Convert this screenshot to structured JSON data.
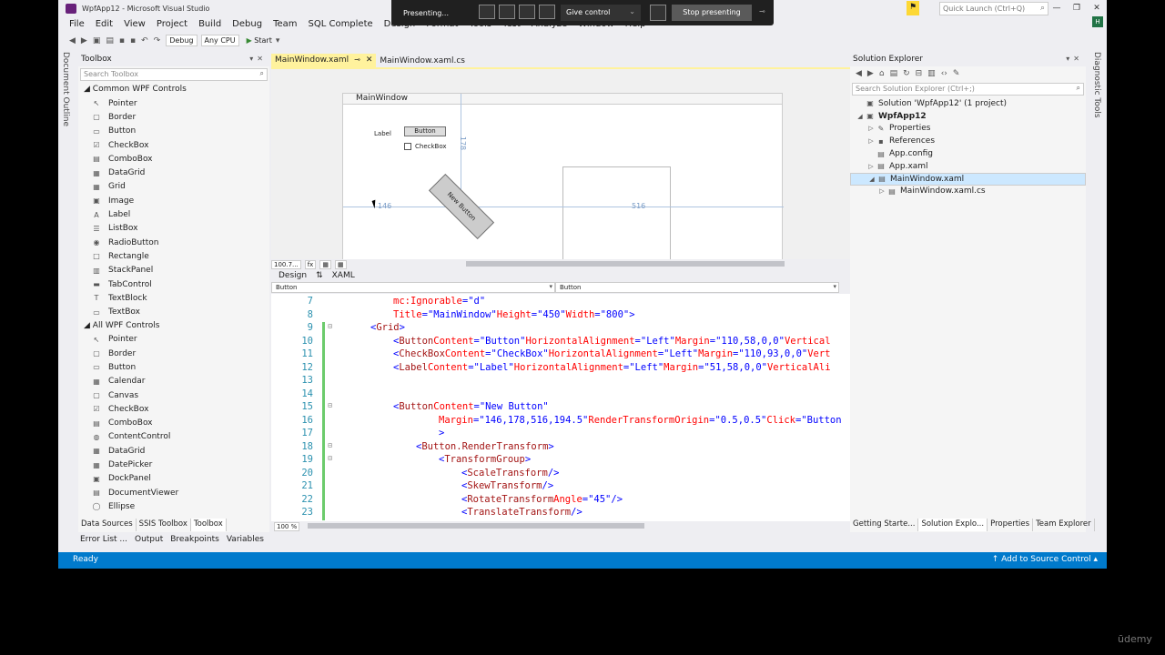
{
  "window": {
    "title": "WpfApp12 - Microsoft Visual Studio",
    "controls": [
      "—",
      "❐",
      "✕"
    ]
  },
  "quick_launch": {
    "placeholder": "Quick Launch (Ctrl+Q)"
  },
  "account_initial": "H",
  "menu": [
    "File",
    "Edit",
    "View",
    "Project",
    "Build",
    "Debug",
    "Team",
    "SQL Complete",
    "Design",
    "Format",
    "Tools",
    "Test",
    "Analyze",
    "Window",
    "Help"
  ],
  "toolbar": {
    "config": "Debug",
    "platform": "Any CPU",
    "start": "Start"
  },
  "presenting": {
    "status": "Presenting...",
    "give_control": "Give control",
    "stop": "Stop presenting"
  },
  "side": {
    "document_outline": "Document Outline",
    "diagnostic_tools": "Diagnostic Tools"
  },
  "toolbox": {
    "title": "Toolbox",
    "search_placeholder": "Search Toolbox",
    "common_header": "Common WPF Controls",
    "common_items": [
      {
        "label": "Pointer",
        "icon": "pointer-icon",
        "glyph": "↖"
      },
      {
        "label": "Border",
        "icon": "border-icon",
        "glyph": "▢"
      },
      {
        "label": "Button",
        "icon": "button-icon",
        "glyph": "▭"
      },
      {
        "label": "CheckBox",
        "icon": "checkbox-icon",
        "glyph": "☑"
      },
      {
        "label": "ComboBox",
        "icon": "combobox-icon",
        "glyph": "▤"
      },
      {
        "label": "DataGrid",
        "icon": "datagrid-icon",
        "glyph": "▦"
      },
      {
        "label": "Grid",
        "icon": "grid-icon",
        "glyph": "▦"
      },
      {
        "label": "Image",
        "icon": "image-icon",
        "glyph": "▣"
      },
      {
        "label": "Label",
        "icon": "label-icon",
        "glyph": "A"
      },
      {
        "label": "ListBox",
        "icon": "listbox-icon",
        "glyph": "☰"
      },
      {
        "label": "RadioButton",
        "icon": "radiobutton-icon",
        "glyph": "◉"
      },
      {
        "label": "Rectangle",
        "icon": "rectangle-icon",
        "glyph": "□"
      },
      {
        "label": "StackPanel",
        "icon": "stackpanel-icon",
        "glyph": "▥"
      },
      {
        "label": "TabControl",
        "icon": "tabcontrol-icon",
        "glyph": "▬"
      },
      {
        "label": "TextBlock",
        "icon": "textblock-icon",
        "glyph": "T"
      },
      {
        "label": "TextBox",
        "icon": "textbox-icon",
        "glyph": "▭"
      }
    ],
    "all_header": "All WPF Controls",
    "all_items": [
      {
        "label": "Pointer",
        "icon": "pointer-icon",
        "glyph": "↖"
      },
      {
        "label": "Border",
        "icon": "border-icon",
        "glyph": "▢"
      },
      {
        "label": "Button",
        "icon": "button-icon",
        "glyph": "▭"
      },
      {
        "label": "Calendar",
        "icon": "calendar-icon",
        "glyph": "▦"
      },
      {
        "label": "Canvas",
        "icon": "canvas-icon",
        "glyph": "▢"
      },
      {
        "label": "CheckBox",
        "icon": "checkbox-icon",
        "glyph": "☑"
      },
      {
        "label": "ComboBox",
        "icon": "combobox-icon",
        "glyph": "▤"
      },
      {
        "label": "ContentControl",
        "icon": "contentcontrol-icon",
        "glyph": "◍"
      },
      {
        "label": "DataGrid",
        "icon": "datagrid-icon",
        "glyph": "▦"
      },
      {
        "label": "DatePicker",
        "icon": "datepicker-icon",
        "glyph": "▦"
      },
      {
        "label": "DockPanel",
        "icon": "dockpanel-icon",
        "glyph": "▣"
      },
      {
        "label": "DocumentViewer",
        "icon": "documentviewer-icon",
        "glyph": "▤"
      },
      {
        "label": "Ellipse",
        "icon": "ellipse-icon",
        "glyph": "◯"
      }
    ],
    "tabs": [
      "Data Sources",
      "SSIS Toolbox",
      "Toolbox"
    ]
  },
  "editor": {
    "tabs": [
      "MainWindow.xaml",
      "MainWindow.xaml.cs"
    ],
    "designer": {
      "window_title": "MainWindow",
      "label": "Label",
      "button": "Button",
      "checkbox": "CheckBox",
      "new_button": "New Button",
      "dim_left": "146",
      "dim_right": "516",
      "dim_top": "178"
    },
    "zoom_top": "100.7...",
    "fx": "fx",
    "split_design": "Design",
    "split_swap": "⇅",
    "split_xaml": "XAML",
    "selector_left": "Button",
    "selector_right": "Button",
    "zoom_code": "100 %",
    "code_lines": [
      {
        "n": "7",
        "fold": "",
        "chg": false,
        "ind": 2,
        "parts": [
          [
            "attr",
            "mc:Ignorable"
          ],
          [
            "op",
            "="
          ],
          [
            "val",
            "\"d\""
          ]
        ]
      },
      {
        "n": "8",
        "fold": "",
        "chg": false,
        "ind": 2,
        "parts": [
          [
            "attr",
            "Title"
          ],
          [
            "op",
            "="
          ],
          [
            "val",
            "\"MainWindow\""
          ],
          [
            "txt",
            " "
          ],
          [
            "attr",
            "Height"
          ],
          [
            "op",
            "="
          ],
          [
            "val",
            "\"450\""
          ],
          [
            "txt",
            " "
          ],
          [
            "attr",
            "Width"
          ],
          [
            "op",
            "="
          ],
          [
            "val",
            "\"800\""
          ],
          [
            "op",
            ">"
          ]
        ]
      },
      {
        "n": "9",
        "fold": "⊟",
        "chg": true,
        "ind": 1,
        "parts": [
          [
            "op",
            "<"
          ],
          [
            "tag",
            "Grid"
          ],
          [
            "op",
            ">"
          ]
        ]
      },
      {
        "n": "10",
        "fold": "",
        "chg": true,
        "ind": 2,
        "parts": [
          [
            "op",
            "<"
          ],
          [
            "tag",
            "Button"
          ],
          [
            "txt",
            " "
          ],
          [
            "attr",
            "Content"
          ],
          [
            "op",
            "="
          ],
          [
            "val",
            "\"Button\""
          ],
          [
            "txt",
            " "
          ],
          [
            "attr",
            "HorizontalAlignment"
          ],
          [
            "op",
            "="
          ],
          [
            "val",
            "\"Left\""
          ],
          [
            "txt",
            " "
          ],
          [
            "attr",
            "Margin"
          ],
          [
            "op",
            "="
          ],
          [
            "val",
            "\"110,58,0,0\""
          ],
          [
            "txt",
            " "
          ],
          [
            "attr",
            "Vertical"
          ]
        ]
      },
      {
        "n": "11",
        "fold": "",
        "chg": true,
        "ind": 2,
        "parts": [
          [
            "op",
            "<"
          ],
          [
            "tag",
            "CheckBox"
          ],
          [
            "txt",
            " "
          ],
          [
            "attr",
            "Content"
          ],
          [
            "op",
            "="
          ],
          [
            "val",
            "\"CheckBox\""
          ],
          [
            "txt",
            " "
          ],
          [
            "attr",
            "HorizontalAlignment"
          ],
          [
            "op",
            "="
          ],
          [
            "val",
            "\"Left\""
          ],
          [
            "txt",
            " "
          ],
          [
            "attr",
            "Margin"
          ],
          [
            "op",
            "="
          ],
          [
            "val",
            "\"110,93,0,0\""
          ],
          [
            "txt",
            " "
          ],
          [
            "attr",
            "Vert"
          ]
        ]
      },
      {
        "n": "12",
        "fold": "",
        "chg": true,
        "ind": 2,
        "parts": [
          [
            "op",
            "<"
          ],
          [
            "tag",
            "Label"
          ],
          [
            "txt",
            " "
          ],
          [
            "attr",
            "Content"
          ],
          [
            "op",
            "="
          ],
          [
            "val",
            "\"Label\""
          ],
          [
            "txt",
            " "
          ],
          [
            "attr",
            "HorizontalAlignment"
          ],
          [
            "op",
            "="
          ],
          [
            "val",
            "\"Left\""
          ],
          [
            "txt",
            " "
          ],
          [
            "attr",
            "Margin"
          ],
          [
            "op",
            "="
          ],
          [
            "val",
            "\"51,58,0,0\""
          ],
          [
            "txt",
            " "
          ],
          [
            "attr",
            "VerticalAli"
          ]
        ]
      },
      {
        "n": "13",
        "fold": "",
        "chg": true,
        "ind": 0,
        "parts": []
      },
      {
        "n": "14",
        "fold": "",
        "chg": true,
        "ind": 0,
        "parts": []
      },
      {
        "n": "15",
        "fold": "⊟",
        "chg": true,
        "ind": 2,
        "parts": [
          [
            "op",
            "<"
          ],
          [
            "tag",
            "Button"
          ],
          [
            "txt",
            " "
          ],
          [
            "attr",
            "Content"
          ],
          [
            "op",
            "="
          ],
          [
            "val",
            "\"New Button\""
          ]
        ]
      },
      {
        "n": "16",
        "fold": "",
        "chg": true,
        "ind": 4,
        "parts": [
          [
            "attr",
            "Margin"
          ],
          [
            "op",
            "="
          ],
          [
            "val",
            "\"146,178,516,194.5\""
          ],
          [
            "txt",
            " "
          ],
          [
            "attr",
            "RenderTransformOrigin"
          ],
          [
            "op",
            "="
          ],
          [
            "val",
            "\"0.5,0.5\""
          ],
          [
            "txt",
            " "
          ],
          [
            "attr",
            "Click"
          ],
          [
            "op",
            "="
          ],
          [
            "val",
            "\"Button"
          ]
        ]
      },
      {
        "n": "17",
        "fold": "",
        "chg": true,
        "ind": 4,
        "parts": [
          [
            "op",
            ">"
          ]
        ]
      },
      {
        "n": "18",
        "fold": "⊟",
        "chg": true,
        "ind": 3,
        "parts": [
          [
            "op",
            "<"
          ],
          [
            "tag",
            "Button.RenderTransform"
          ],
          [
            "op",
            ">"
          ]
        ]
      },
      {
        "n": "19",
        "fold": "⊟",
        "chg": true,
        "ind": 4,
        "parts": [
          [
            "op",
            "<"
          ],
          [
            "tag",
            "TransformGroup"
          ],
          [
            "op",
            ">"
          ]
        ]
      },
      {
        "n": "20",
        "fold": "",
        "chg": true,
        "ind": 5,
        "parts": [
          [
            "op",
            "<"
          ],
          [
            "tag",
            "ScaleTransform"
          ],
          [
            "op",
            "/>"
          ]
        ]
      },
      {
        "n": "21",
        "fold": "",
        "chg": true,
        "ind": 5,
        "parts": [
          [
            "op",
            "<"
          ],
          [
            "tag",
            "SkewTransform"
          ],
          [
            "op",
            "/>"
          ]
        ]
      },
      {
        "n": "22",
        "fold": "",
        "chg": true,
        "ind": 5,
        "parts": [
          [
            "op",
            "<"
          ],
          [
            "tag",
            "RotateTransform"
          ],
          [
            "txt",
            " "
          ],
          [
            "attr",
            "Angle"
          ],
          [
            "op",
            "="
          ],
          [
            "val",
            "\"45\""
          ],
          [
            "op",
            "/>"
          ]
        ]
      },
      {
        "n": "23",
        "fold": "",
        "chg": true,
        "ind": 5,
        "parts": [
          [
            "op",
            "<"
          ],
          [
            "tag",
            "TranslateTransform"
          ],
          [
            "op",
            "/>"
          ]
        ]
      }
    ]
  },
  "solution_explorer": {
    "title": "Solution Explorer",
    "search_placeholder": "Search Solution Explorer (Ctrl+;)",
    "tree": [
      {
        "label": "Solution 'WpfApp12' (1 project)",
        "depth": 0,
        "exp": "",
        "icon": "solution-icon",
        "glyph": "▣",
        "bold": false,
        "selected": false
      },
      {
        "label": "WpfApp12",
        "depth": 0,
        "exp": "◢",
        "icon": "project-icon",
        "glyph": "▣",
        "bold": true,
        "selected": false
      },
      {
        "label": "Properties",
        "depth": 1,
        "exp": "▷",
        "icon": "wrench-icon",
        "glyph": "✎",
        "bold": false,
        "selected": false
      },
      {
        "label": "References",
        "depth": 1,
        "exp": "▷",
        "icon": "references-icon",
        "glyph": "▪",
        "bold": false,
        "selected": false
      },
      {
        "label": "App.config",
        "depth": 1,
        "exp": "",
        "icon": "config-file-icon",
        "glyph": "▤",
        "bold": false,
        "selected": false
      },
      {
        "label": "App.xaml",
        "depth": 1,
        "exp": "▷",
        "icon": "xaml-file-icon",
        "glyph": "▤",
        "bold": false,
        "selected": false
      },
      {
        "label": "MainWindow.xaml",
        "depth": 1,
        "exp": "◢",
        "icon": "xaml-file-icon",
        "glyph": "▤",
        "bold": false,
        "selected": true
      },
      {
        "label": "MainWindow.xaml.cs",
        "depth": 2,
        "exp": "▷",
        "icon": "cs-file-icon",
        "glyph": "▤",
        "bold": false,
        "selected": false
      }
    ],
    "tabs": [
      "Getting Starte...",
      "Solution Explo...",
      "Properties",
      "Team Explorer"
    ]
  },
  "bottom_tabs": [
    "Error List ...",
    "Output",
    "Breakpoints",
    "Variables"
  ],
  "status": {
    "ready": "Ready",
    "source_control": "↑ Add to Source Control ▴"
  },
  "watermark": "ūdemy",
  "colors": {
    "accent": "#007acc",
    "active_tab": "#fff29d",
    "change_bar": "#6ccb6c"
  }
}
